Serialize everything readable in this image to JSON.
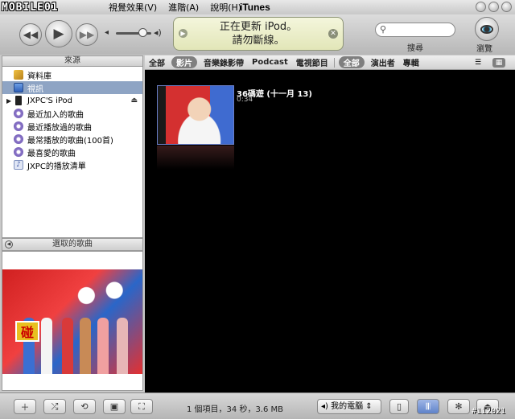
{
  "window": {
    "logo_text": "MOBILE01",
    "title": "iTunes",
    "menu": [
      "視覺效果(V)",
      "進階(A)",
      "說明(H)"
    ]
  },
  "player": {
    "prev_icon": "rewind-icon",
    "play_icon": "play-icon",
    "next_icon": "fast-forward-icon",
    "volume_level": 0.75,
    "lcd_line1": "正在更新 iPod。",
    "lcd_line2": "請勿斷線。",
    "search_placeholder": "",
    "search_label": "搜尋",
    "browse_label": "瀏覽"
  },
  "sidebar": {
    "header": "來源",
    "items": [
      {
        "label": "資料庫",
        "icon": "library-icon",
        "selected": false
      },
      {
        "label": "視訊",
        "icon": "video-icon",
        "selected": true
      },
      {
        "label": "JXPC'S iPod",
        "icon": "ipod-icon",
        "selected": false
      },
      {
        "label": "最近加入的歌曲",
        "icon": "smart-playlist-icon",
        "selected": false
      },
      {
        "label": "最近播放過的歌曲",
        "icon": "smart-playlist-icon",
        "selected": false
      },
      {
        "label": "最常播放的歌曲(100首)",
        "icon": "smart-playlist-icon",
        "selected": false
      },
      {
        "label": "最喜愛的歌曲",
        "icon": "smart-playlist-icon",
        "selected": false
      },
      {
        "label": "JXPC的播放清單",
        "icon": "playlist-icon",
        "selected": false
      }
    ],
    "selected_song_header": "選取的歌曲",
    "artwork_badge": "碰"
  },
  "browser": {
    "filters": [
      "全部",
      "影片",
      "音樂錄影帶",
      "Podcast",
      "電視節目"
    ],
    "active_filter": "影片",
    "right_filters": [
      "全部",
      "演出者",
      "專輯"
    ],
    "active_right_filter": "全部"
  },
  "videos": [
    {
      "title": "36碼遊 (十一月 13)",
      "duration": "0:34"
    }
  ],
  "status_bar": {
    "summary": "1 個項目，34 秒，3.6 MB",
    "speaker": "我的電腦",
    "watermark": "#112021"
  }
}
